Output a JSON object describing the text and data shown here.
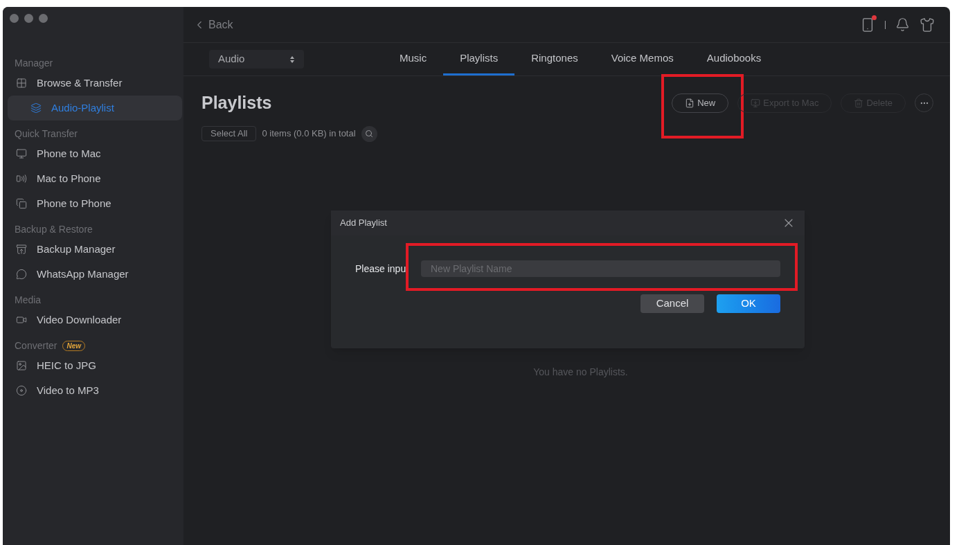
{
  "sidebar": {
    "sections": [
      {
        "title": "Manager",
        "items": [
          {
            "label": "Browse & Transfer",
            "selected": false,
            "indented": false
          },
          {
            "label": "Audio-Playlist",
            "selected": true,
            "indented": true
          }
        ]
      },
      {
        "title": "Quick Transfer",
        "items": [
          {
            "label": "Phone to Mac",
            "selected": false,
            "indented": false
          },
          {
            "label": "Mac to Phone",
            "selected": false,
            "indented": false
          },
          {
            "label": "Phone to Phone",
            "selected": false,
            "indented": false
          }
        ]
      },
      {
        "title": "Backup & Restore",
        "items": [
          {
            "label": "Backup Manager",
            "selected": false,
            "indented": false
          },
          {
            "label": "WhatsApp Manager",
            "selected": false,
            "indented": false
          }
        ]
      },
      {
        "title": "Media",
        "items": [
          {
            "label": "Video Downloader",
            "selected": false,
            "indented": false
          }
        ]
      },
      {
        "title": "Converter",
        "badge": "New",
        "items": [
          {
            "label": "HEIC to JPG",
            "selected": false,
            "indented": false
          },
          {
            "label": "Video to MP3",
            "selected": false,
            "indented": false
          }
        ]
      }
    ]
  },
  "topbar": {
    "back": "Back"
  },
  "category_select": {
    "value": "Audio"
  },
  "tabs": [
    {
      "label": "Music",
      "selected": false
    },
    {
      "label": "Playlists",
      "selected": true
    },
    {
      "label": "Ringtones",
      "selected": false
    },
    {
      "label": "Voice Memos",
      "selected": false
    },
    {
      "label": "Audiobooks",
      "selected": false
    }
  ],
  "page": {
    "title": "Playlists",
    "select_all": "Select All",
    "summary": "0 items (0.0 KB) in total",
    "empty_message": "You have no Playlists."
  },
  "actions": [
    {
      "label": "New",
      "disabled": false,
      "highlighted": true
    },
    {
      "label": "Export to Mac",
      "disabled": true,
      "highlighted": false
    },
    {
      "label": "Delete",
      "disabled": true,
      "highlighted": false
    }
  ],
  "dialog": {
    "title": "Add Playlist",
    "label": "Please inpu",
    "field": {
      "placeholder": "New Playlist Name",
      "highlighted": true
    },
    "buttons": [
      {
        "label": "Cancel",
        "kind": "secondary"
      },
      {
        "label": "OK",
        "kind": "primary"
      }
    ]
  }
}
